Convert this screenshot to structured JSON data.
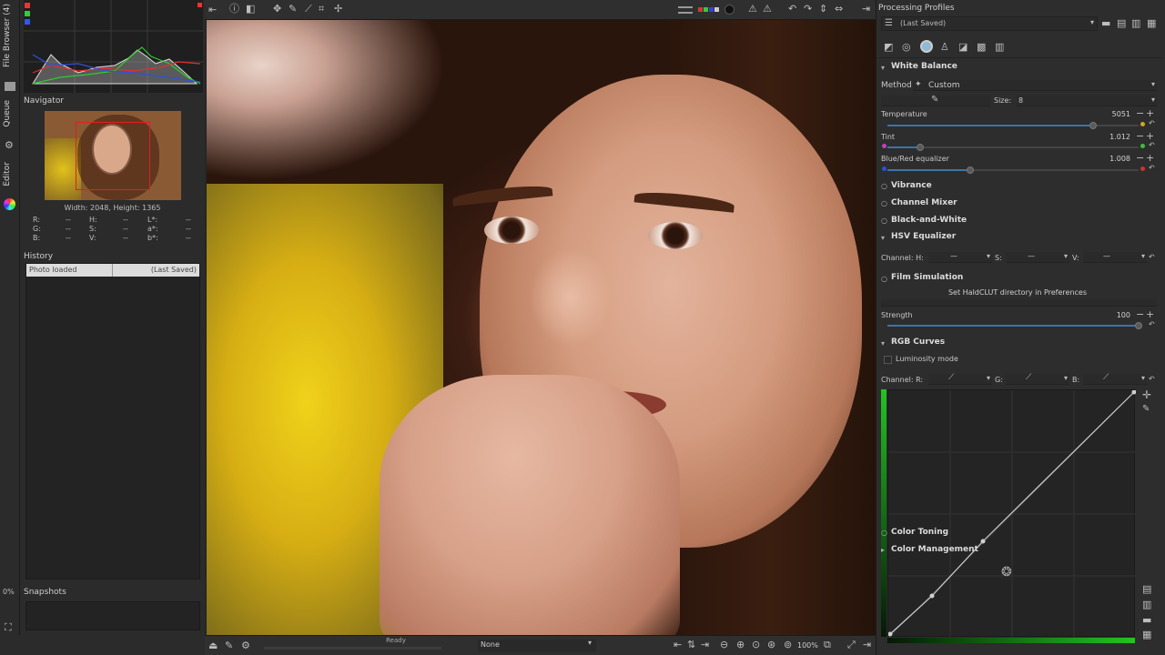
{
  "left_tabs": [
    "File Browser (4)",
    "Queue",
    "Editor"
  ],
  "left_percent": "0%",
  "navigator": {
    "title": "Navigator",
    "size_text": "Width: 2048, Height: 1365",
    "info": [
      [
        "R:",
        "--",
        "H:",
        "--",
        "L*:",
        "--"
      ],
      [
        "G:",
        "--",
        "S:",
        "--",
        "a*:",
        "--"
      ],
      [
        "B:",
        "--",
        "V:",
        "--",
        "b*:",
        "--"
      ]
    ]
  },
  "history": {
    "title": "History",
    "rows": [
      {
        "action": "Photo loaded",
        "profile": "(Last Saved)"
      }
    ]
  },
  "snapshots": {
    "title": "Snapshots",
    "add": "+",
    "remove": "−"
  },
  "status": {
    "ready": "Ready",
    "mode": "None",
    "zoom": "100%"
  },
  "processing_profiles": {
    "title": "Processing Profiles",
    "selected": "(Last Saved)"
  },
  "white_balance": {
    "title": "White Balance",
    "method_label": "Method",
    "method_value": "Custom",
    "size_label": "Size:",
    "size_value": "8",
    "temperature": {
      "label": "Temperature",
      "value": "5051",
      "fraction": 0.82
    },
    "tint": {
      "label": "Tint",
      "value": "1.012",
      "fraction": 0.13
    },
    "blue_red": {
      "label": "Blue/Red equalizer",
      "value": "1.008",
      "fraction": 0.33
    }
  },
  "sections": {
    "vibrance": "Vibrance",
    "channel_mixer": "Channel Mixer",
    "black_white": "Black-and-White",
    "hsv": "HSV Equalizer",
    "film": "Film Simulation",
    "rgb": "RGB Curves",
    "toning": "Color Toning",
    "color_mgmt": "Color Management"
  },
  "hsv_channels": {
    "h": "Channel: H:",
    "s": "S:",
    "v": "V:",
    "dash": "—"
  },
  "film": {
    "message": "Set HaldCLUT directory in Preferences",
    "strength_label": "Strength",
    "strength_value": "100",
    "strength_fraction": 1.0
  },
  "rgb_curves": {
    "luminosity": "Luminosity mode",
    "r": "Channel: R:",
    "g": "G:",
    "b": "B:"
  },
  "colors": {
    "accent": "#3b74a8",
    "curve_green": "#22c422",
    "history_selected": "#dcdcdc"
  }
}
